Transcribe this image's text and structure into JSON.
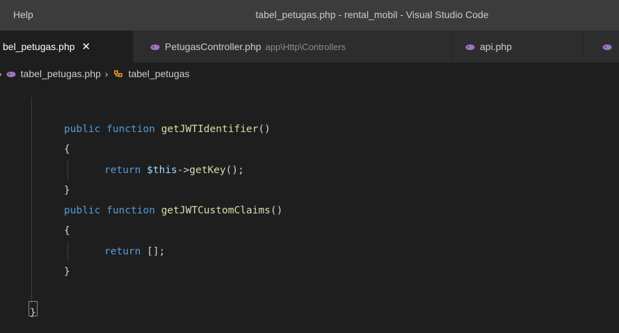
{
  "titlebar": {
    "menu_help": "Help",
    "title": "tabel_petugas.php - rental_mobil - Visual Studio Code"
  },
  "tabs": [
    {
      "label": "bel_petugas.php",
      "active": true,
      "close": "✕"
    },
    {
      "label": "PetugasController.php",
      "description": "app\\Http\\Controllers"
    },
    {
      "label": "api.php"
    }
  ],
  "breadcrumb": {
    "chevron_start": "›",
    "file": "tabel_petugas.php",
    "separator": "›",
    "symbol": "tabel_petugas"
  },
  "code": {
    "line1": {
      "kw1": "public",
      "kw2": "function",
      "name": "getJWTIdentifier",
      "parens": "()"
    },
    "line2": {
      "brace": "{"
    },
    "line3": {
      "kw": "return",
      "var": "$this",
      "arrow": "->",
      "call": "getKey",
      "tail": "();"
    },
    "line4": {
      "brace": "}"
    },
    "line5": {
      "kw1": "public",
      "kw2": "function",
      "name": "getJWTCustomClaims",
      "parens": "()"
    },
    "line6": {
      "brace": "{"
    },
    "line7": {
      "kw": "return",
      "tail": "[];"
    },
    "line8": {
      "brace": "}"
    },
    "line9": {
      "brace": "}"
    }
  },
  "colors": {
    "keyword": "#569cd6",
    "function": "#dcdcaa",
    "variable": "#9cdcfe",
    "php_icon": "#a074c4",
    "symbol_icon": "#ee9d28"
  }
}
